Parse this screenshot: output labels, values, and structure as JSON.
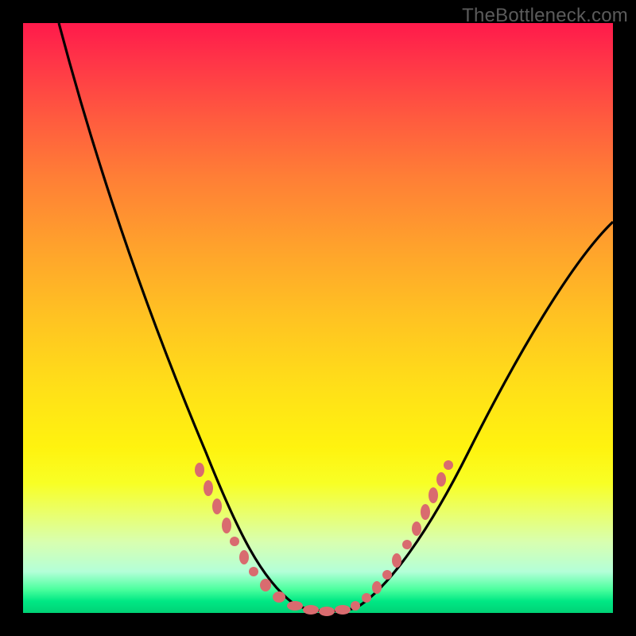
{
  "watermark": "TheBottleneck.com",
  "chart_data": {
    "type": "line",
    "title": "",
    "xlabel": "",
    "ylabel": "",
    "xlim": [
      0,
      100
    ],
    "ylim": [
      0,
      100
    ],
    "grid": false,
    "legend": false,
    "series": [
      {
        "name": "bottleneck-curve",
        "x": [
          6,
          10,
          15,
          20,
          25,
          28,
          30,
          33,
          36,
          38,
          40,
          42,
          44,
          46,
          48,
          50,
          53,
          56,
          60,
          64,
          68,
          72,
          76,
          80,
          84,
          88,
          92,
          96,
          100
        ],
        "y": [
          100,
          90,
          78,
          66,
          54,
          46,
          40,
          32,
          24,
          18,
          12,
          7,
          3,
          1,
          0,
          0,
          0,
          1,
          4,
          9,
          15,
          22,
          29,
          36,
          43,
          50,
          56,
          61,
          66
        ]
      }
    ],
    "markers": [
      {
        "x": 29,
        "y": 23
      },
      {
        "x": 30.5,
        "y": 20
      },
      {
        "x": 32,
        "y": 17
      },
      {
        "x": 33.5,
        "y": 14
      },
      {
        "x": 35,
        "y": 11
      },
      {
        "x": 36.5,
        "y": 8.5
      },
      {
        "x": 38,
        "y": 6
      },
      {
        "x": 40,
        "y": 3.5
      },
      {
        "x": 42,
        "y": 1.5
      },
      {
        "x": 44,
        "y": 0.5
      },
      {
        "x": 46,
        "y": 0
      },
      {
        "x": 48,
        "y": 0
      },
      {
        "x": 50,
        "y": 0
      },
      {
        "x": 52,
        "y": 0
      },
      {
        "x": 54,
        "y": 0.5
      },
      {
        "x": 56,
        "y": 1.5
      },
      {
        "x": 58,
        "y": 3.5
      },
      {
        "x": 60,
        "y": 6
      },
      {
        "x": 62,
        "y": 9
      },
      {
        "x": 64,
        "y": 13
      },
      {
        "x": 65.5,
        "y": 16
      },
      {
        "x": 67,
        "y": 19
      },
      {
        "x": 68.5,
        "y": 22
      },
      {
        "x": 70,
        "y": 25
      }
    ],
    "colors": {
      "curve": "#000000",
      "markers": "#d96b6f"
    }
  }
}
